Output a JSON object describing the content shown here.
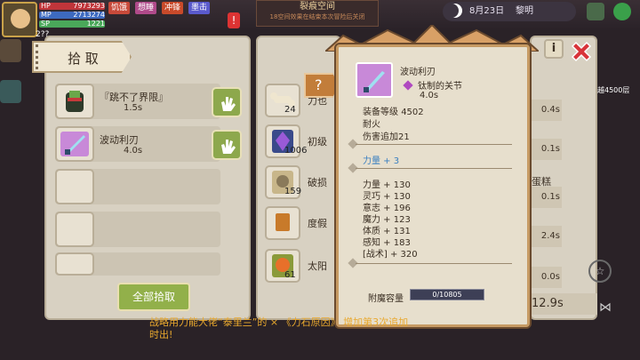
{
  "hud": {
    "hp_label": "HP",
    "hp_value": "7973293",
    "mp_label": "MP",
    "mp_value": "2713274",
    "sp_label": "SP",
    "sp_value": "1221",
    "level": "2??",
    "debuffs": [
      "饥饿",
      "想睡",
      "冲锋",
      "墨击"
    ],
    "rift_title": "裂痕空间",
    "rift_sub": "18空间效果在结束本次冒险后关闭",
    "date": "8月23日",
    "time_of_day": "黎明",
    "floor_text": "越4500层"
  },
  "pickup": {
    "title": "拾 取",
    "items": [
      {
        "name": "『跳不了界限』",
        "time": "1.5s"
      },
      {
        "name": "波动利刃",
        "time": "4.0s"
      },
      {
        "name": "",
        "time": ""
      },
      {
        "name": "",
        "time": ""
      },
      {
        "name": "",
        "time": ""
      }
    ],
    "pickup_all": "全部拾取"
  },
  "middle": {
    "items": [
      {
        "count": "24",
        "name": "力也"
      },
      {
        "count": "1006",
        "name": "初级"
      },
      {
        "count": "159",
        "name": "破损"
      },
      {
        "count": "",
        "name": "度假"
      },
      {
        "count": "61",
        "name": "太阳"
      }
    ]
  },
  "right": {
    "times": [
      "0.4s",
      "0.1s",
      "0.1s",
      "2.4s",
      "0.0s"
    ],
    "cake": "蛋糕",
    "big_time": "12.9s"
  },
  "tooltip": {
    "name": "波动利刃",
    "material": "钛制的关节",
    "cast_time": "4.0s",
    "equip_level_label": "装备等级",
    "equip_level": "4502",
    "trait1": "耐火",
    "trait2": "伤害追加21",
    "bonus": "力量 + 3",
    "stats": [
      "力量 + 130",
      "灵巧 + 130",
      "意志 + 196",
      "魔力 + 123",
      "体质 + 131",
      "感知 + 183",
      "[战术] + 320"
    ],
    "enchant_label": "附魔容量",
    "enchant_value": "0/10805"
  },
  "bottom_text": "战略用力能大佬“泰里兰”的 × 《力石原因》 增加第3次追加时出!",
  "colors": {
    "accent": "#92b04a",
    "frame": "#c69a63",
    "close": "#d8343a",
    "bonus_blue": "#3a7fc0"
  }
}
